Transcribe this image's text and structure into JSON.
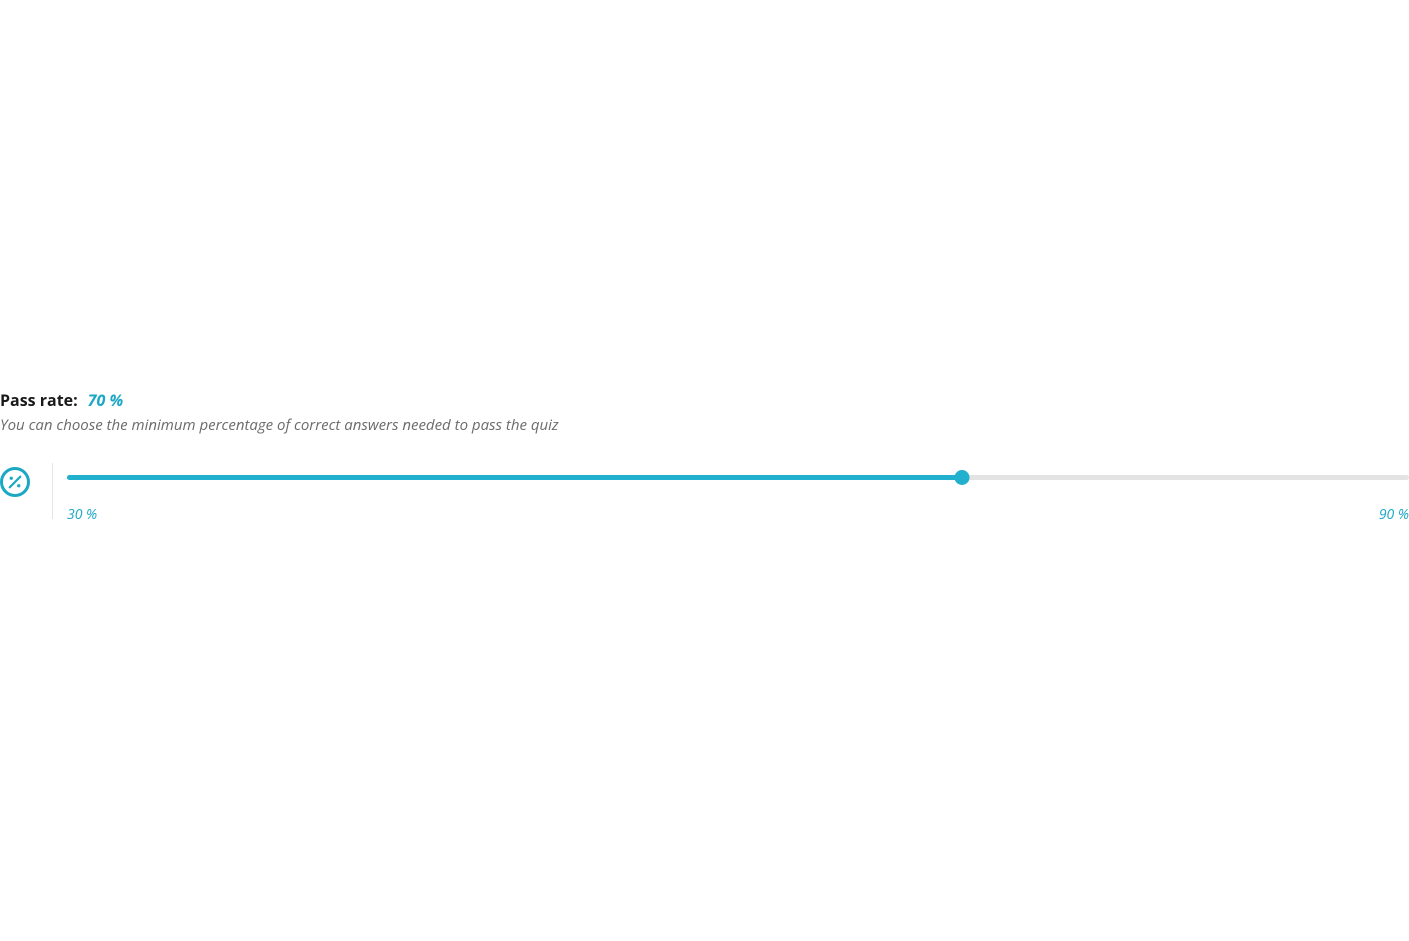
{
  "passRate": {
    "label": "Pass rate:",
    "value": "70 %",
    "description": "You can choose the minimum percentage of correct answers needed to pass the quiz",
    "minLabel": "30 %",
    "maxLabel": "90 %",
    "min": 30,
    "max": 90,
    "current": 70,
    "accentColor": "#1ba8c4"
  }
}
